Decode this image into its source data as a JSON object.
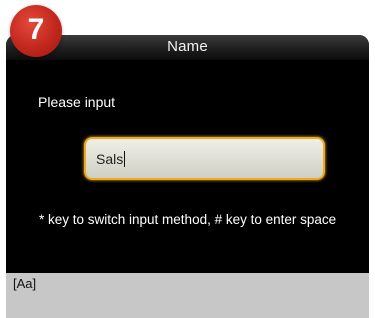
{
  "step_badge": {
    "number": "7",
    "color": "#c2271d"
  },
  "window": {
    "title": "Name"
  },
  "form": {
    "prompt": "Please input",
    "input_value": "Sals",
    "focus_color": "#f0a91c"
  },
  "hint": {
    "text": "* key to switch input method, # key to enter space"
  },
  "status_bar": {
    "input_mode": "[Aa]"
  }
}
